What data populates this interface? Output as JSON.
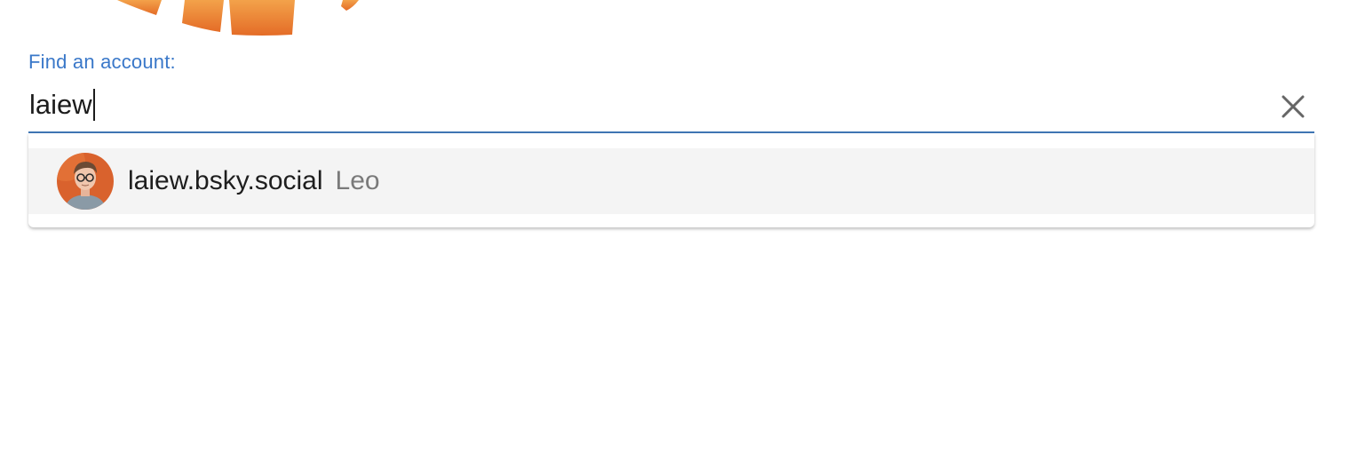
{
  "search": {
    "label": "Find an account:",
    "value": "laiew"
  },
  "results": [
    {
      "handle": "laiew.bsky.social",
      "display_name": "Leo"
    }
  ],
  "colors": {
    "accent": "#3a78c9",
    "underline": "#3f76b5",
    "logo": "#e8732c",
    "row_bg": "#f4f4f4"
  },
  "icons": {
    "logo": "sunburst-logo",
    "clear": "close-icon"
  }
}
